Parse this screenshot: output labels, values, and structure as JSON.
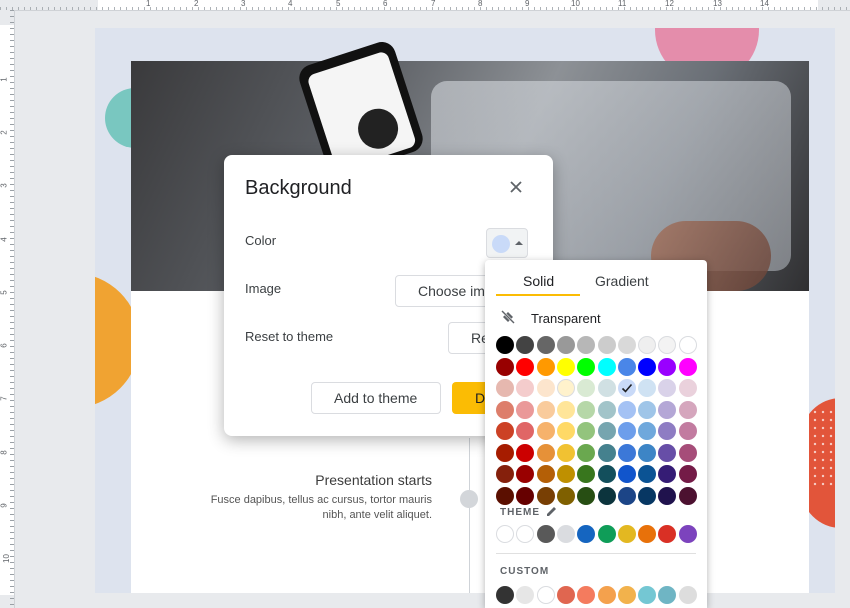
{
  "ruler": {
    "top_numbers": [
      "1",
      "2",
      "3",
      "4",
      "5",
      "6",
      "7",
      "8",
      "9",
      "10",
      "11",
      "12",
      "13",
      "14"
    ],
    "left_numbers": [
      "1",
      "2",
      "3",
      "4",
      "5",
      "6",
      "7",
      "8",
      "9",
      "10"
    ]
  },
  "slide": {
    "title": "Presentation starts",
    "body": "Fusce dapibus, tellus ac cursus, tortor mauris nibh, ante velit aliquet."
  },
  "dialog": {
    "title": "Background",
    "color_label": "Color",
    "image_label": "Image",
    "reset_label": "Reset to theme",
    "choose_image_button": "Choose image",
    "reset_button": "Reset",
    "add_to_theme_button": "Add to theme",
    "done_button": "Done",
    "current_color": "#c9daf8"
  },
  "picker": {
    "tabs": [
      "Solid",
      "Gradient"
    ],
    "active_tab": "Solid",
    "transparent_label": "Transparent",
    "theme_label": "THEME",
    "custom_label": "CUSTOM",
    "selected_color": "#c9daf8",
    "rows": [
      [
        "#000000",
        "#434343",
        "#666666",
        "#999999",
        "#b7b7b7",
        "#cccccc",
        "#d9d9d9",
        "#efefef",
        "#f3f3f3",
        "#ffffff"
      ],
      [
        "#980000",
        "#ff0000",
        "#ff9900",
        "#ffff00",
        "#00ff00",
        "#00ffff",
        "#4a86e8",
        "#0000ff",
        "#9900ff",
        "#ff00ff"
      ],
      [
        "#e6b8af",
        "#f4cccc",
        "#fce5cd",
        "#fff2cc",
        "#d9ead3",
        "#d0e0e3",
        "#c9daf8",
        "#cfe2f3",
        "#d9d2e9",
        "#ead1dc"
      ],
      [
        "#dd7e6b",
        "#ea9999",
        "#f9cb9c",
        "#ffe599",
        "#b6d7a8",
        "#a2c4c9",
        "#a4c2f4",
        "#9fc5e8",
        "#b4a7d6",
        "#d5a6bd"
      ],
      [
        "#cc4125",
        "#e06666",
        "#f6b26b",
        "#ffd966",
        "#93c47d",
        "#76a5af",
        "#6d9eeb",
        "#6fa8dc",
        "#8e7cc3",
        "#c27ba0"
      ],
      [
        "#a61c00",
        "#cc0000",
        "#e69138",
        "#f1c232",
        "#6aa84f",
        "#45818e",
        "#3c78d8",
        "#3d85c6",
        "#674ea7",
        "#a64d79"
      ],
      [
        "#85200c",
        "#990000",
        "#b45f06",
        "#bf9000",
        "#38761d",
        "#134f5c",
        "#1155cc",
        "#0b5394",
        "#351c75",
        "#741b47"
      ],
      [
        "#5b0f00",
        "#660000",
        "#783f04",
        "#7f6000",
        "#274e13",
        "#0c343d",
        "#1c4587",
        "#073763",
        "#20124d",
        "#4c1130"
      ]
    ],
    "theme_colors": [
      "#ffffff",
      "#ffffff",
      "#595959",
      "#dadce0",
      "#1565c0",
      "#0f9d58",
      "#e3b821",
      "#e8710a",
      "#d93025",
      "#7c43bd"
    ],
    "custom_colors": [
      "#333333",
      "#e6e6e6",
      "#ffffff",
      "#e06650",
      "#f47b5e",
      "#f4a14d",
      "#f2b24c",
      "#74c7d3",
      "#6fb5c4",
      "#dddddd"
    ]
  }
}
